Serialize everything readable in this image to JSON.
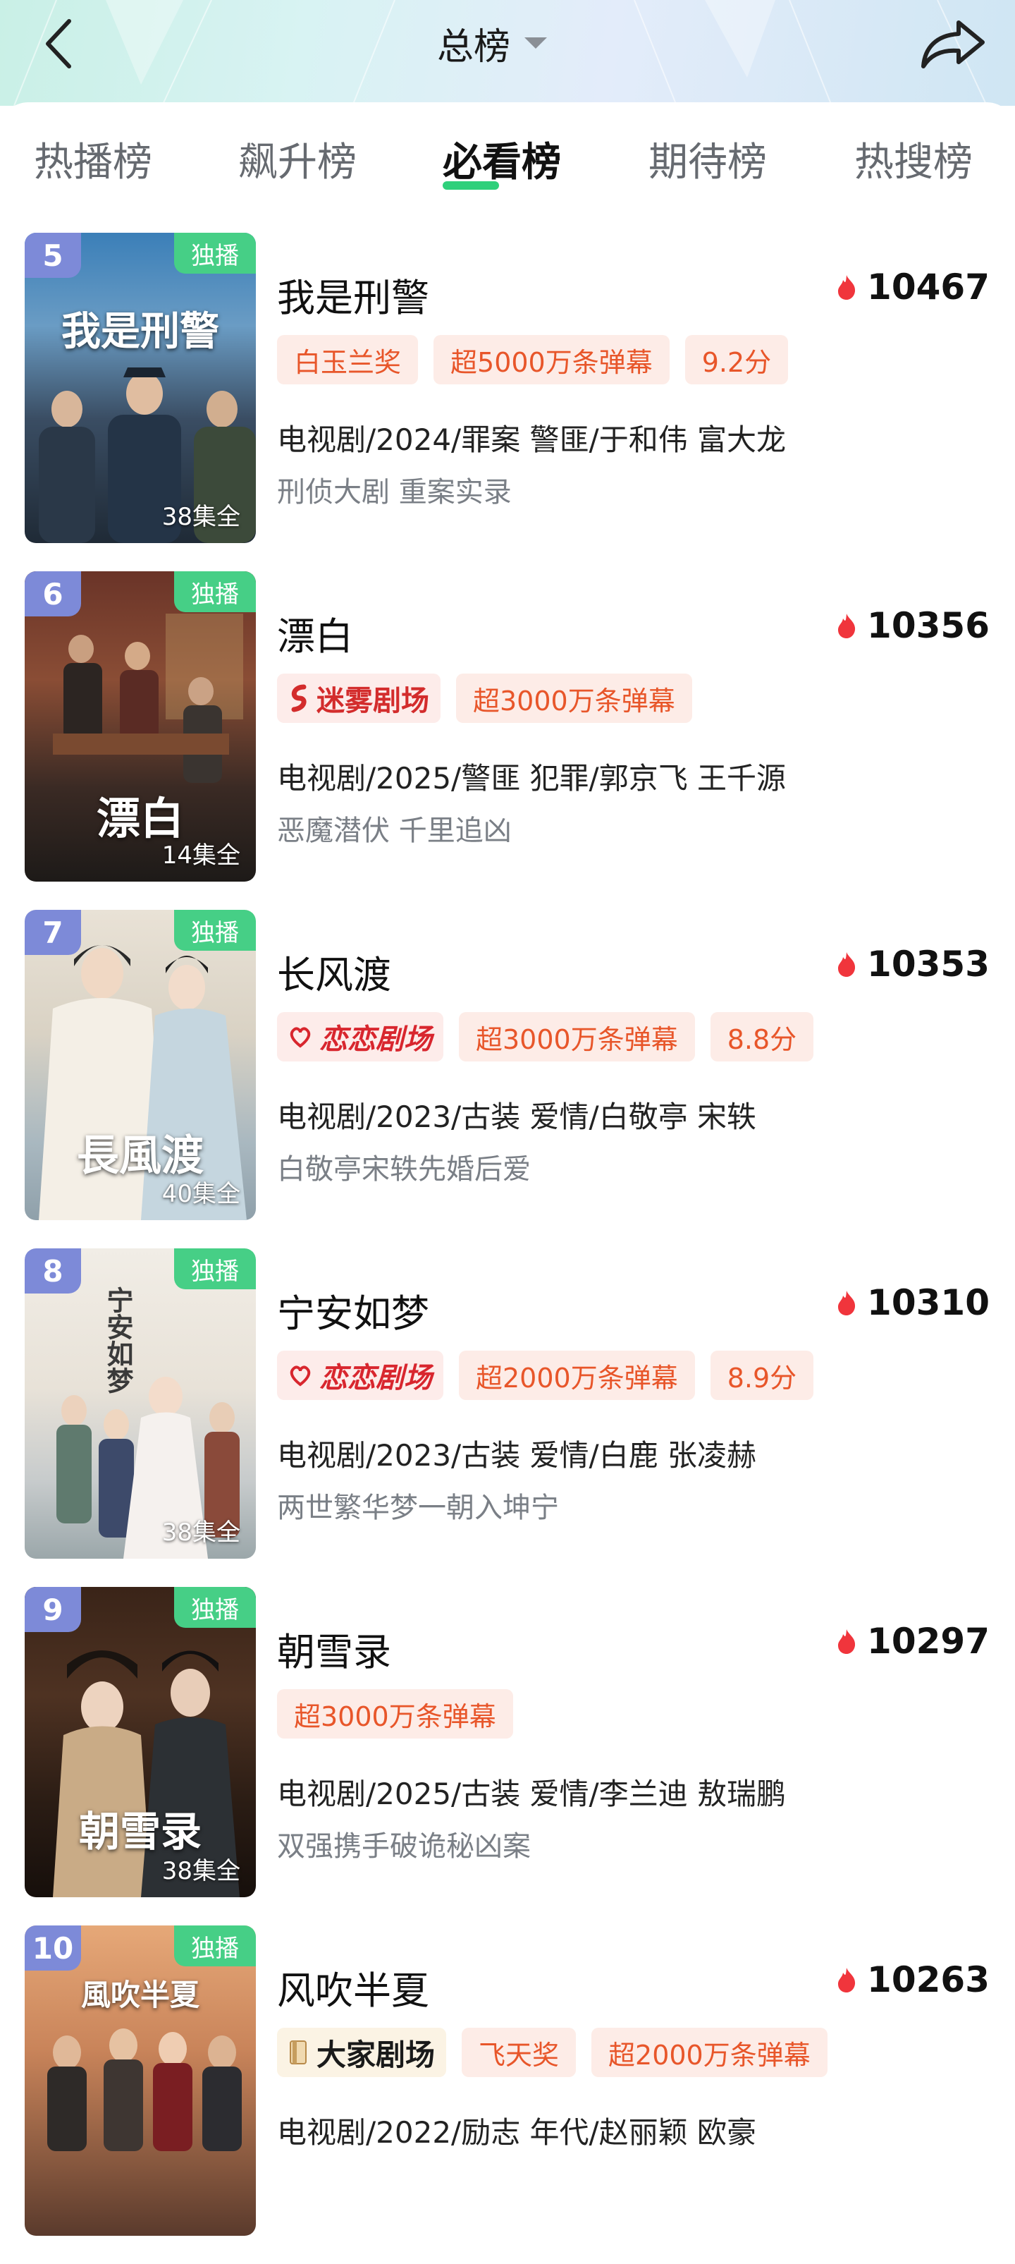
{
  "header": {
    "title": "总榜"
  },
  "tabs": [
    "热播榜",
    "飙升榜",
    "必看榜",
    "期待榜",
    "热搜榜"
  ],
  "active_tab": 2,
  "colors": {
    "accent_green": "#2fd07b",
    "tag_text": "#e8562a",
    "tag_bg": "#fdece7",
    "rank_badge": "#7d8ad8",
    "exclusive_badge": "#46cf86"
  },
  "icons": {
    "back": "chevron-left-icon",
    "share": "share-arrow-icon",
    "heat": "flame-icon",
    "dropdown": "caret-down-icon"
  },
  "items": [
    {
      "rank": "5",
      "badge": "独播",
      "episodes": "38集全",
      "poster_title": "我是刑警",
      "name": "我是刑警",
      "heat": "10467",
      "tags": [
        "白玉兰奖",
        "超5000万条弹幕",
        "9.2分"
      ],
      "meta": "电视剧/2024/罪案 警匪/于和伟 富大龙",
      "desc": "刑侦大剧 重案实录"
    },
    {
      "rank": "6",
      "badge": "独播",
      "episodes": "14集全",
      "poster_title": "漂白",
      "name": "漂白",
      "heat": "10356",
      "brand": "迷雾剧场",
      "tags": [
        "超3000万条弹幕"
      ],
      "meta": "电视剧/2025/警匪 犯罪/郭京飞 王千源",
      "desc": "恶魔潜伏 千里追凶"
    },
    {
      "rank": "7",
      "badge": "独播",
      "episodes": "40集全",
      "poster_title": "長風渡",
      "name": "长风渡",
      "heat": "10353",
      "brand": "恋恋剧场",
      "tags": [
        "超3000万条弹幕",
        "8.8分"
      ],
      "meta": "电视剧/2023/古装 爱情/白敬亭 宋轶",
      "desc": "白敬亭宋轶先婚后爱"
    },
    {
      "rank": "8",
      "badge": "独播",
      "episodes": "38集全",
      "poster_title": "宁安如梦",
      "name": "宁安如梦",
      "heat": "10310",
      "brand": "恋恋剧场",
      "tags": [
        "超2000万条弹幕",
        "8.9分"
      ],
      "meta": "电视剧/2023/古装 爱情/白鹿 张凌赫",
      "desc": "两世繁华梦一朝入坤宁"
    },
    {
      "rank": "9",
      "badge": "独播",
      "episodes": "38集全",
      "poster_title": "朝雪录",
      "name": "朝雪录",
      "heat": "10297",
      "tags": [
        "超3000万条弹幕"
      ],
      "meta": "电视剧/2025/古装 爱情/李兰迪 敖瑞鹏",
      "desc": "双强携手破诡秘凶案"
    },
    {
      "rank": "10",
      "badge": "独播",
      "poster_title": "風吹半夏",
      "name": "风吹半夏",
      "heat": "10263",
      "brand": "大家剧场",
      "tags": [
        "飞天奖",
        "超2000万条弹幕"
      ],
      "meta": "电视剧/2022/励志 年代/赵丽颖 欧豪"
    }
  ]
}
